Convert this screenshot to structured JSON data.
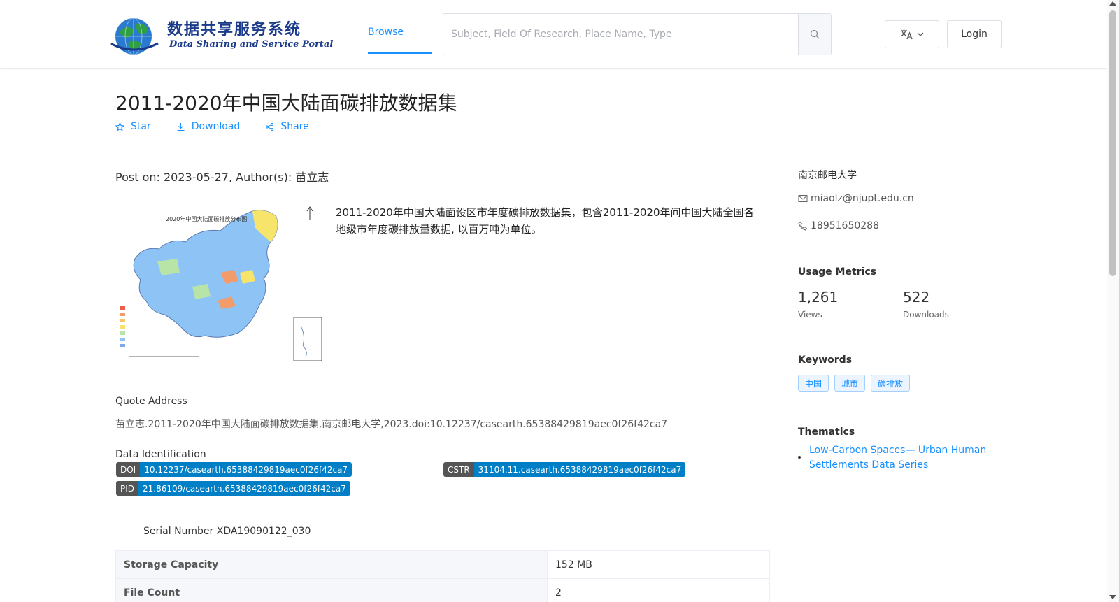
{
  "header": {
    "logo": {
      "title": "数据共享服务系统",
      "subtitle": "Data Sharing and Service Portal"
    },
    "nav_browse": "Browse",
    "search_placeholder": "Subject, Field Of Research, Place Name, Type",
    "login_label": "Login"
  },
  "dataset": {
    "title": "2011-2020年中国大陆面碳排放数据集",
    "actions": {
      "star": "Star",
      "download": "Download",
      "share": "Share"
    },
    "post_line": "Post on: 2023-05-27, Author(s): 苗立志",
    "description": "2011-2020年中国大陆面设区市年度碳排放数据集，包含2011-2020年间中国大陆全国各地级市年度碳排放量数据, 以百万吨为单位。",
    "quote_label": "Quote Address",
    "quote_text": "苗立志.2011-2020年中国大陆面碳排放数据集,南京邮电大学,2023.doi:10.12237/casearth.65388429819aec0f26f42ca7",
    "ident_label": "Data Identification",
    "identifiers": {
      "doi_key": "DOI",
      "doi_val": "10.12237/casearth.65388429819aec0f26f42ca7",
      "cstr_key": "CSTR",
      "cstr_val": "31104.11.casearth.65388429819aec0f26f42ca7",
      "pid_key": "PID",
      "pid_val": "21.86109/casearth.65388429819aec0f26f42ca7"
    },
    "serial": "Serial Number XDA19090122_030",
    "table": [
      {
        "key": "Storage Capacity",
        "value": "152 MB"
      },
      {
        "key": "File Count",
        "value": "2"
      }
    ]
  },
  "sidebar": {
    "org": "南京邮电大学",
    "email": "miaolz@njupt.edu.cn",
    "phone": "18951650288",
    "metrics_heading": "Usage Metrics",
    "views_value": "1,261",
    "views_label": "Views",
    "downloads_value": "522",
    "downloads_label": "Downloads",
    "keywords_heading": "Keywords",
    "keywords": [
      "中国",
      "城市",
      "碳排放"
    ],
    "thematics_heading": "Thematics",
    "thematic_link": "Low-Carbon Spaces— Urban Human Settlements Data Series"
  },
  "colors": {
    "accent": "#1890ff",
    "badge_value": "#007ec6",
    "badge_key": "#555555"
  },
  "icons": [
    "globe-logo-icon",
    "search-icon",
    "translate-icon",
    "chevron-down-icon",
    "star-icon",
    "download-icon",
    "share-icon",
    "mail-icon",
    "phone-icon"
  ]
}
